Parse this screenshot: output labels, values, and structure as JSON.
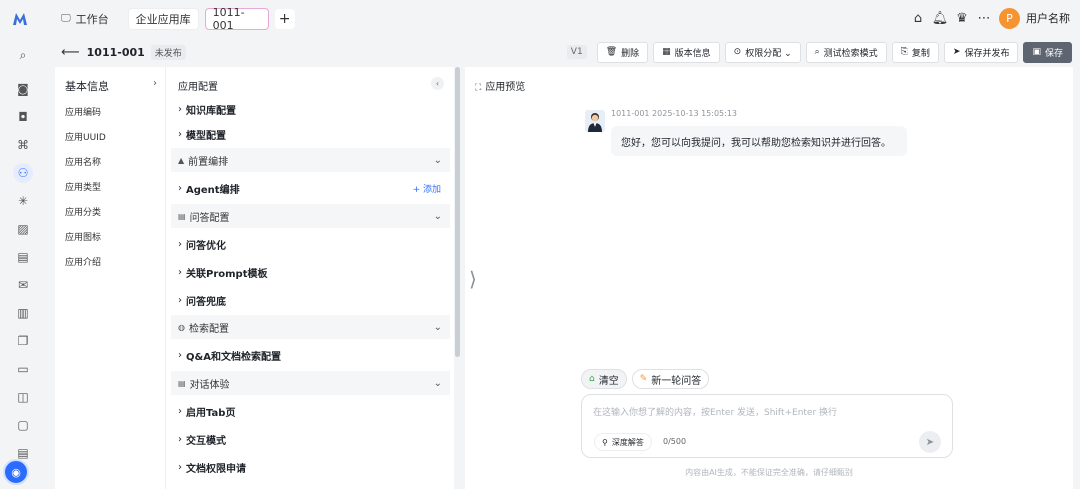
{
  "tabs": {
    "workbench": "工作台",
    "enterprise_lib": "企业应用库",
    "current": "1011-001",
    "add": "+"
  },
  "user": {
    "avatar_letter": "P",
    "name": "用户名称"
  },
  "header": {
    "back": "⟵",
    "title": "1011-001",
    "status": "未发布",
    "version": "V1"
  },
  "actions": [
    {
      "icon": "🗑",
      "label": "删除"
    },
    {
      "icon": "▦",
      "label": "版本信息"
    },
    {
      "icon": "⊙",
      "label": "权限分配 ⌄"
    },
    {
      "icon": "⌕",
      "label": "测试检索模式"
    },
    {
      "icon": "⎘",
      "label": "复制"
    },
    {
      "icon": "➤",
      "label": "保存并发布"
    },
    {
      "icon": "▣",
      "label": "保存"
    }
  ],
  "info": {
    "title": "基本信息",
    "chevron": "›",
    "items": [
      "应用编码",
      "应用UUID",
      "应用名称",
      "应用类型",
      "应用分类",
      "应用图标",
      "应用介绍"
    ]
  },
  "config": {
    "title": "应用配置",
    "collapse": "‹",
    "rows": [
      {
        "type": "b",
        "label": "知识库配置"
      },
      {
        "type": "b",
        "label": "模型配置"
      },
      {
        "type": "g",
        "label": "前置编排"
      },
      {
        "type": "b",
        "label": "Agent编排",
        "add": "+ 添加"
      },
      {
        "type": "g",
        "label": "问答配置"
      },
      {
        "type": "b",
        "label": "问答优化"
      },
      {
        "type": "b",
        "label": "关联Prompt模板"
      },
      {
        "type": "b",
        "label": "问答兜底"
      },
      {
        "type": "g",
        "label": "检索配置"
      },
      {
        "type": "b",
        "label": "Q&A和文档检索配置"
      },
      {
        "type": "g",
        "label": "对话体验"
      },
      {
        "type": "b",
        "label": "启用Tab页"
      },
      {
        "type": "b",
        "label": "交互模式"
      },
      {
        "type": "b",
        "label": "文档权限申请"
      }
    ]
  },
  "preview": {
    "title": "应用预览",
    "side_arrow": "⟩",
    "meta": "1011-001 2025-10-13 15:05:13",
    "message": "您好，您可以向我提问，我可以帮助您检索知识并进行回答。",
    "clear": "清空",
    "new_round": "新一轮问答",
    "placeholder": "在这输入你想了解的内容，按Enter 发送，Shift+Enter 换行",
    "deep": "深度解答",
    "count": "0/500",
    "disclaimer": "内容由AI生成，不能保证完全准确，请仔细甄别"
  },
  "colors": {
    "accent": "#3370ff",
    "avatar": "#f59431",
    "save": "#5e6470"
  }
}
